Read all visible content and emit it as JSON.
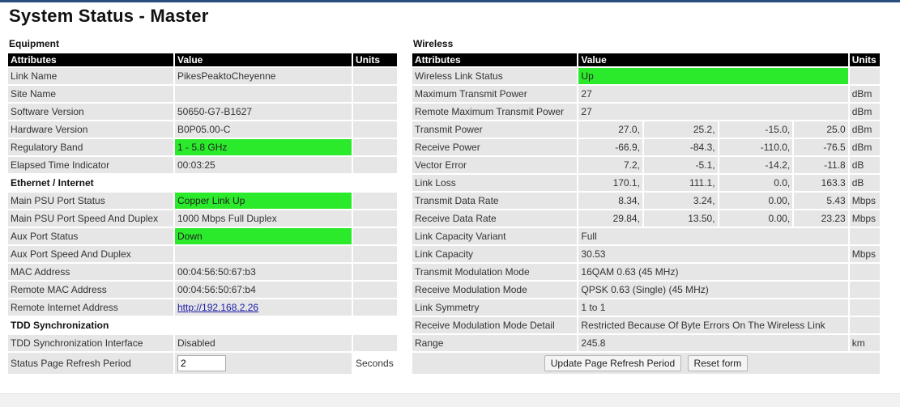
{
  "title": "System Status - Master",
  "equipment": {
    "section_label": "Equipment",
    "headers": {
      "attributes": "Attributes",
      "value": "Value",
      "units": "Units"
    },
    "link_name": {
      "label": "Link Name",
      "value": "PikesPeaktoCheyenne",
      "units": ""
    },
    "site_name": {
      "label": "Site Name",
      "value": "",
      "units": ""
    },
    "software_version": {
      "label": "Software Version",
      "value": "50650-G7-B1627",
      "units": ""
    },
    "hardware_version": {
      "label": "Hardware Version",
      "value": "B0P05.00-C",
      "units": ""
    },
    "regulatory_band": {
      "label": "Regulatory Band",
      "value": "1 - 5.8 GHz",
      "units": ""
    },
    "elapsed_time": {
      "label": "Elapsed Time Indicator",
      "value": "00:03:25",
      "units": ""
    },
    "ethernet_label": "Ethernet / Internet",
    "main_psu_status": {
      "label": "Main PSU Port Status",
      "value": "Copper Link Up",
      "units": ""
    },
    "main_psu_speed": {
      "label": "Main PSU Port Speed And Duplex",
      "value": "1000 Mbps Full Duplex",
      "units": ""
    },
    "aux_port_status": {
      "label": "Aux Port Status",
      "value": "Down",
      "units": ""
    },
    "aux_port_speed": {
      "label": "Aux Port Speed And Duplex",
      "value": "",
      "units": ""
    },
    "mac_address": {
      "label": "MAC Address",
      "value": "00:04:56:50:67:b3",
      "units": ""
    },
    "remote_mac_address": {
      "label": "Remote MAC Address",
      "value": "00:04:56:50:67:b4",
      "units": ""
    },
    "remote_internet_address": {
      "label": "Remote Internet Address",
      "value": "http://192.168.2.26",
      "units": ""
    },
    "tdd_label": "TDD Synchronization",
    "tdd_interface": {
      "label": "TDD Synchronization Interface",
      "value": "Disabled",
      "units": ""
    },
    "refresh_period": {
      "label": "Status Page Refresh Period",
      "value": "2",
      "units": "Seconds"
    }
  },
  "wireless": {
    "section_label": "Wireless",
    "headers": {
      "attributes": "Attributes",
      "value": "Value",
      "units": "Units"
    },
    "link_status": {
      "label": "Wireless Link Status",
      "value": "Up",
      "units": ""
    },
    "max_tx_power": {
      "label": "Maximum Transmit Power",
      "value": "27",
      "units": "dBm"
    },
    "remote_max_tx_power": {
      "label": "Remote Maximum Transmit Power",
      "value": "27",
      "units": "dBm"
    },
    "transmit_power": {
      "label": "Transmit Power",
      "values": [
        "27.0,",
        "25.2,",
        "-15.0,",
        "25.0"
      ],
      "units": "dBm"
    },
    "receive_power": {
      "label": "Receive Power",
      "values": [
        "-66.9,",
        "-84.3,",
        "-110.0,",
        "-76.5"
      ],
      "units": "dBm"
    },
    "vector_error": {
      "label": "Vector Error",
      "values": [
        "7.2,",
        "-5.1,",
        "-14.2,",
        "-11.8"
      ],
      "units": "dB"
    },
    "link_loss": {
      "label": "Link Loss",
      "values": [
        "170.1,",
        "111.1,",
        "0.0,",
        "163.3"
      ],
      "units": "dB"
    },
    "tx_data_rate": {
      "label": "Transmit Data Rate",
      "values": [
        "8.34,",
        "3.24,",
        "0.00,",
        "5.43"
      ],
      "units": "Mbps"
    },
    "rx_data_rate": {
      "label": "Receive Data Rate",
      "values": [
        "29.84,",
        "13.50,",
        "0.00,",
        "23.23"
      ],
      "units": "Mbps"
    },
    "capacity_variant": {
      "label": "Link Capacity Variant",
      "value": "Full",
      "units": ""
    },
    "link_capacity": {
      "label": "Link Capacity",
      "value": "30.53",
      "units": "Mbps"
    },
    "tx_modulation": {
      "label": "Transmit Modulation Mode",
      "value": "16QAM 0.63 (45 MHz)",
      "units": ""
    },
    "rx_modulation": {
      "label": "Receive Modulation Mode",
      "value": "QPSK 0.63 (Single) (45 MHz)",
      "units": ""
    },
    "link_symmetry": {
      "label": "Link Symmetry",
      "value": "1 to 1",
      "units": ""
    },
    "rx_modulation_detail": {
      "label": "Receive Modulation Mode Detail",
      "value": "Restricted Because Of Byte Errors On The Wireless Link",
      "units": ""
    },
    "range": {
      "label": "Range",
      "value": "245.8",
      "units": "km"
    }
  },
  "buttons": {
    "update_refresh": "Update Page Refresh Period",
    "reset_form": "Reset form"
  },
  "colors": {
    "highlight": "#2bea2b",
    "header_bg": "#000000",
    "cell_bg": "#e6e6e6"
  }
}
